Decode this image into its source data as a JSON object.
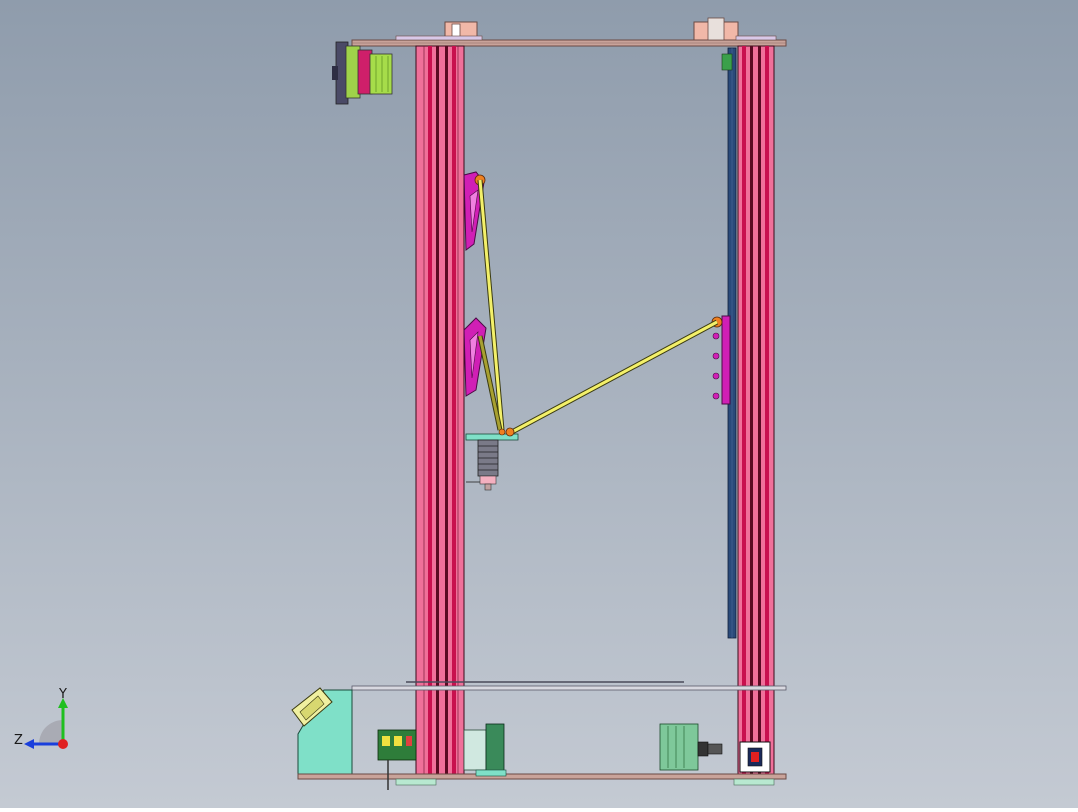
{
  "viewport": {
    "background_top": "#8f9cac",
    "background_bottom": "#c4cad3"
  },
  "triad": {
    "y_label": "Y",
    "z_label": "Z",
    "y_color": "#1fbf1f",
    "z_color": "#1a3fdc",
    "x_color": "#e02020"
  },
  "colors": {
    "column": "#f0709a",
    "column_dark": "#c8104e",
    "plate": "#c9a39a",
    "arm": "#f3f06a",
    "carriage": "#d01fb5",
    "base": "#7fe0c8",
    "motor": "#7ec89a",
    "rail": "#2a4a7a"
  }
}
